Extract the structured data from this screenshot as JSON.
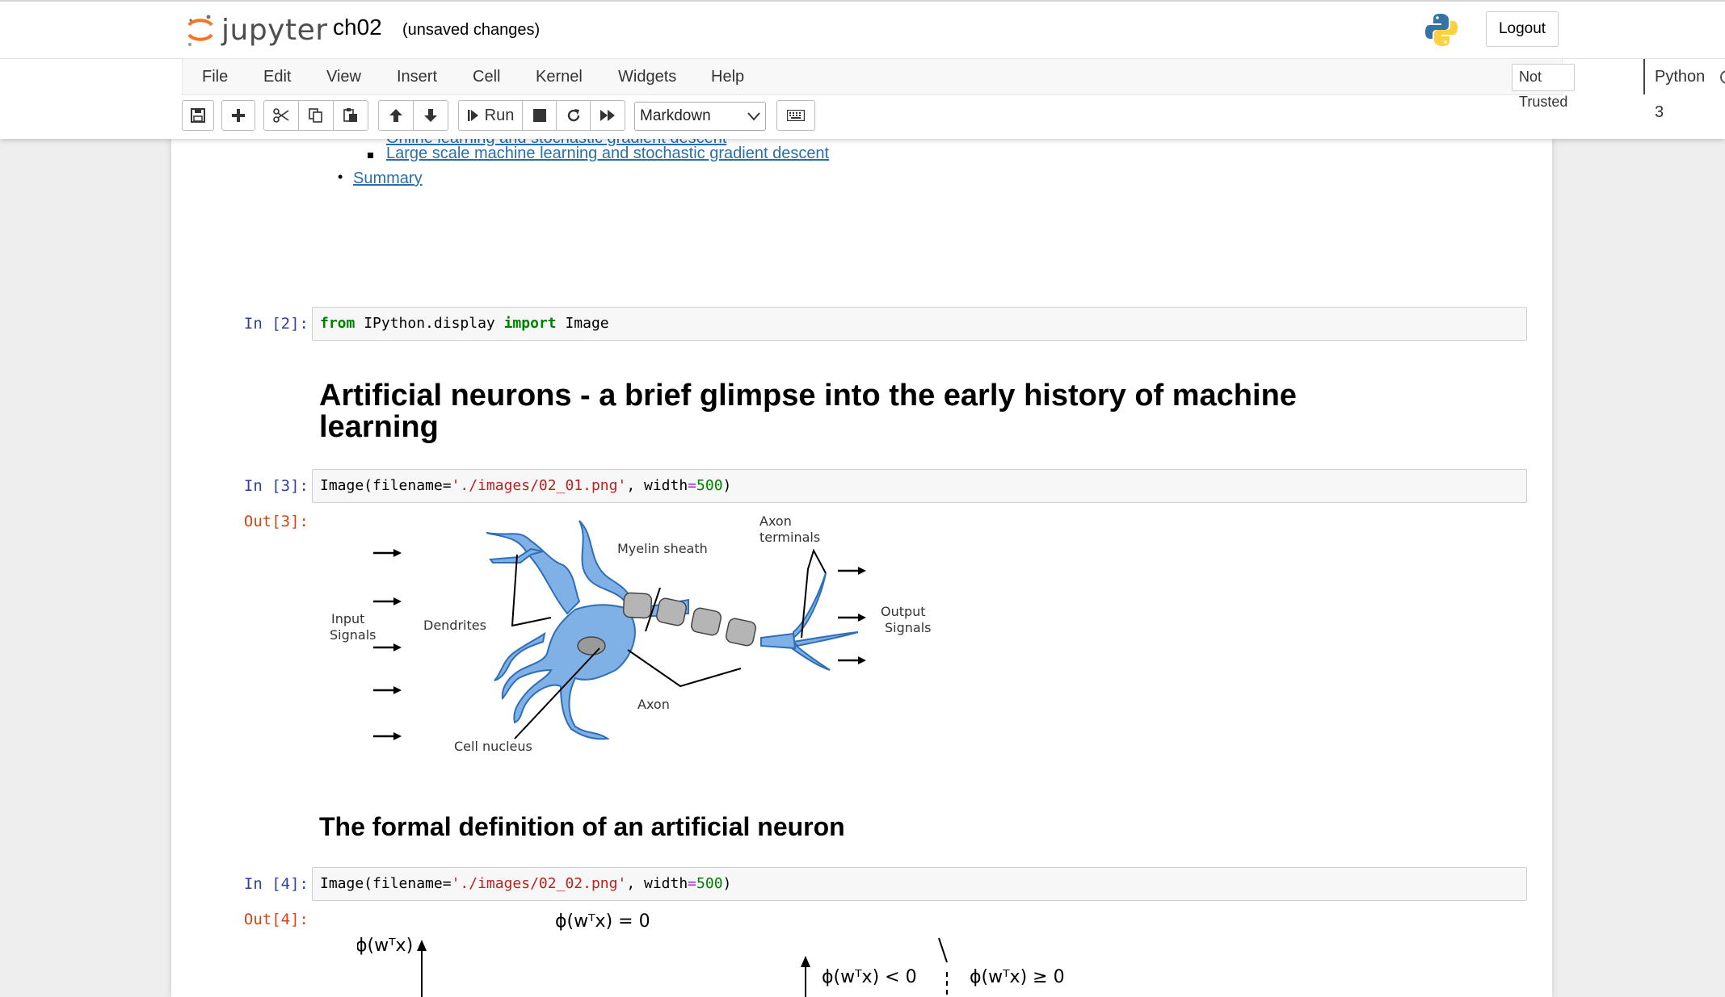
{
  "header": {
    "logo_text": "jupyter",
    "notebook_name": "ch02",
    "save_status": "(unsaved changes)",
    "logout_label": "Logout"
  },
  "menubar": {
    "items": [
      "File",
      "Edit",
      "View",
      "Insert",
      "Cell",
      "Kernel",
      "Widgets",
      "Help"
    ],
    "trust_label": "Not Trusted",
    "kernel_name": "Python 3"
  },
  "toolbar": {
    "run_label": "Run",
    "cell_type": "Markdown",
    "buttons": [
      "save-icon",
      "plus-icon",
      "scissors-icon",
      "copy-icon",
      "paste-icon",
      "arrow-up-icon",
      "arrow-down-icon",
      "run-icon",
      "stop-icon",
      "restart-icon",
      "fast-forward-icon",
      "keyboard-icon"
    ]
  },
  "toc": {
    "items": [
      {
        "level": 2,
        "text": "Large scale machine learning and stochastic gradient descent"
      },
      {
        "level": 1,
        "text": "Summary"
      }
    ]
  },
  "cells": {
    "c2": {
      "prompt": "In  [2]:",
      "code_from": "from",
      "code_mod": " IPython.display ",
      "code_import": "import",
      "code_name": " Image"
    },
    "h1": {
      "text": "Artificial neurons - a brief glimpse into the early history of machine learning"
    },
    "c3": {
      "prompt": "In  [3]:",
      "out_prompt": "Out[3]:",
      "code_pre": "Image(filename=",
      "code_str": "'./images/02_01.png'",
      "code_mid": ", width",
      "code_eq": "=",
      "code_num": "500",
      "code_post": ")"
    },
    "h2": {
      "text": "The formal definition of an artificial neuron"
    },
    "c4": {
      "prompt": "In  [4]:",
      "out_prompt": "Out[4]:",
      "code_pre": "Image(filename=",
      "code_str": "'./images/02_02.png'",
      "code_mid": ", width",
      "code_eq": "=",
      "code_num": "500",
      "code_post": ")"
    }
  },
  "neuron_figure": {
    "labels": {
      "input": [
        "Input",
        "Signals"
      ],
      "dendrites": "Dendrites",
      "cell_nucleus": "Cell nucleus",
      "myelin": "Myelin sheath",
      "axon": "Axon",
      "axon_terminals": [
        "Axon",
        "terminals"
      ],
      "output": [
        "Output",
        "Signals"
      ]
    },
    "colors": {
      "cell": "#7fb0e6",
      "outline": "#2f6fb8",
      "sheath": "#b5b5b5"
    }
  },
  "decision_figure": {
    "labels": {
      "y_axis": "ϕ(wᵀx)",
      "boundary": "ϕ(wᵀx) = 0",
      "left_region": "ϕ(wᵀx) < 0",
      "right_region": "ϕ(wᵀx) ≥ 0"
    }
  }
}
